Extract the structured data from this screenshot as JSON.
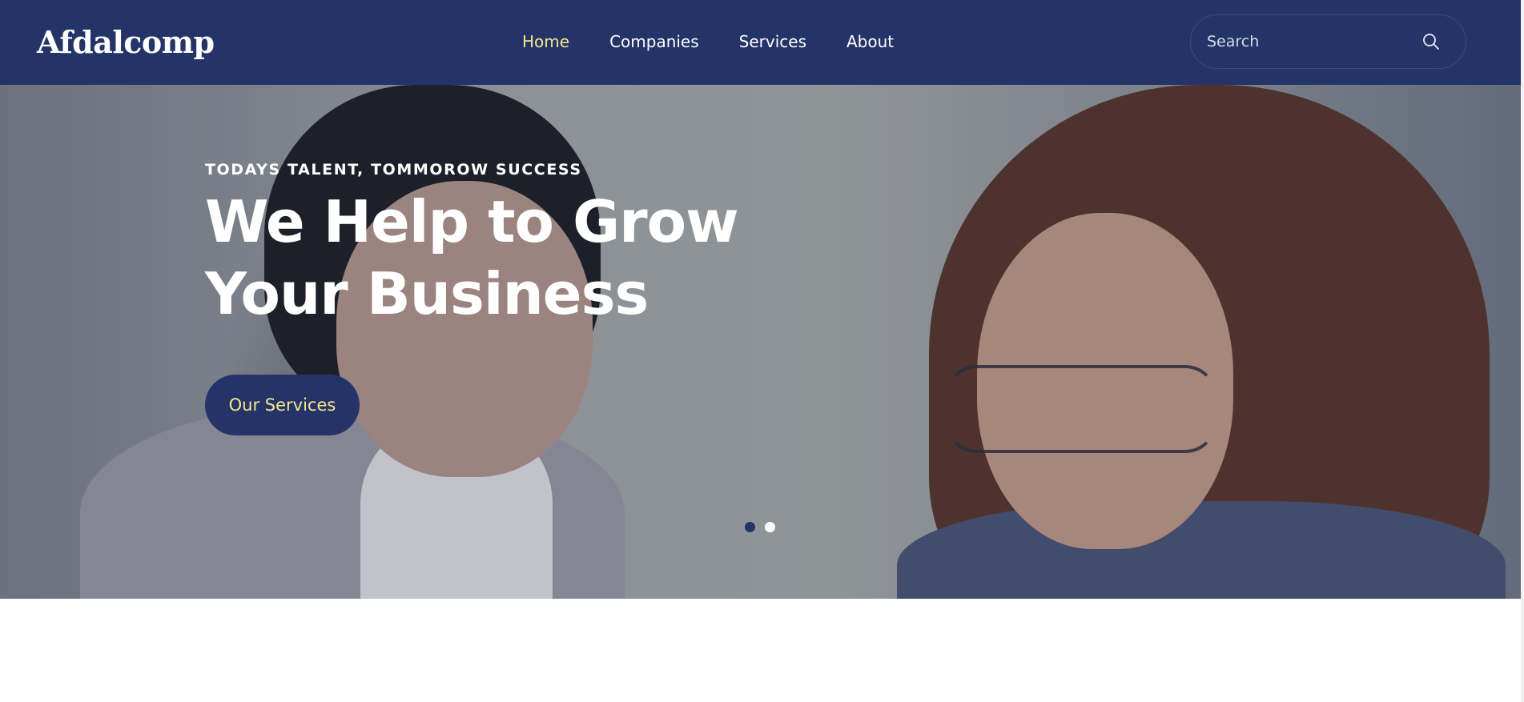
{
  "navbar": {
    "logo_text": "Afdalcomp",
    "links": [
      {
        "label": "Home",
        "active": true
      },
      {
        "label": "Companies",
        "active": false
      },
      {
        "label": "Services",
        "active": false
      },
      {
        "label": "About",
        "active": false
      }
    ],
    "search": {
      "placeholder": "Search",
      "value": ""
    }
  },
  "hero": {
    "tagline": "TODAYS TALENT, TOMMOROW SUCCESS",
    "title_line1": "We Help to Grow",
    "title_line2": "Your Business",
    "button_label": "Our Services",
    "slides": {
      "count": 2,
      "active_index": 0
    }
  },
  "colors": {
    "brand_navy": "#253468",
    "accent_yellow": "#f6e68c",
    "text_white": "#ffffff"
  },
  "icons": {
    "search": "search-icon"
  }
}
